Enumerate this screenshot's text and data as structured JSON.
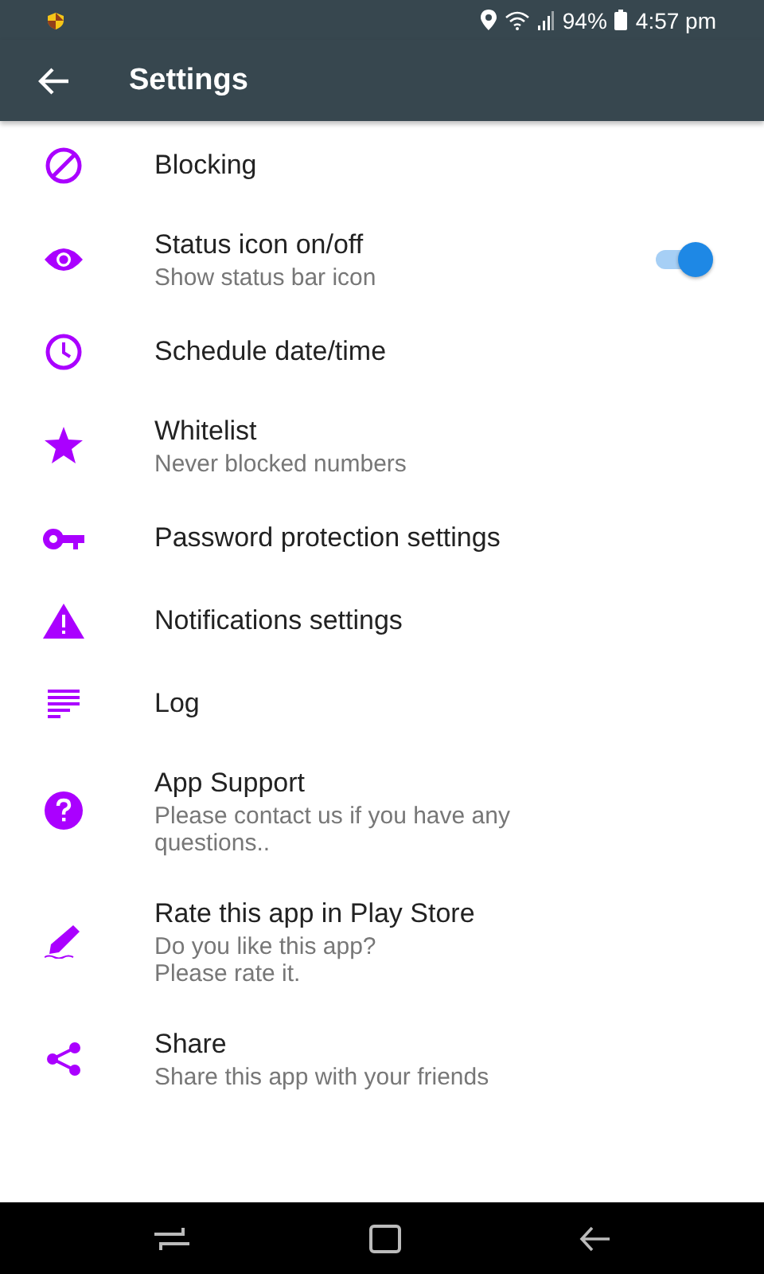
{
  "status_bar": {
    "battery": "94%",
    "time": "4:57 pm"
  },
  "app_bar": {
    "title": "Settings"
  },
  "items": [
    {
      "kind": "block",
      "title": "Blocking"
    },
    {
      "kind": "eye",
      "title": "Status icon on/off",
      "subtitle": "Show status bar icon",
      "toggle": {
        "on": true
      }
    },
    {
      "kind": "clock",
      "title": "Schedule date/time"
    },
    {
      "kind": "star",
      "title": "Whitelist",
      "subtitle": "Never blocked numbers"
    },
    {
      "kind": "key",
      "title": "Password protection settings"
    },
    {
      "kind": "warning",
      "title": "Notifications settings"
    },
    {
      "kind": "log",
      "title": "Log"
    },
    {
      "kind": "help",
      "title": "App Support",
      "subtitle": "Please contact us if you have any questions.."
    },
    {
      "kind": "pen",
      "title": "Rate this app in Play Store",
      "subtitle": "Do you like this app?\nPlease rate it."
    },
    {
      "kind": "share",
      "title": "Share",
      "subtitle": "Share this app with your friends"
    }
  ]
}
